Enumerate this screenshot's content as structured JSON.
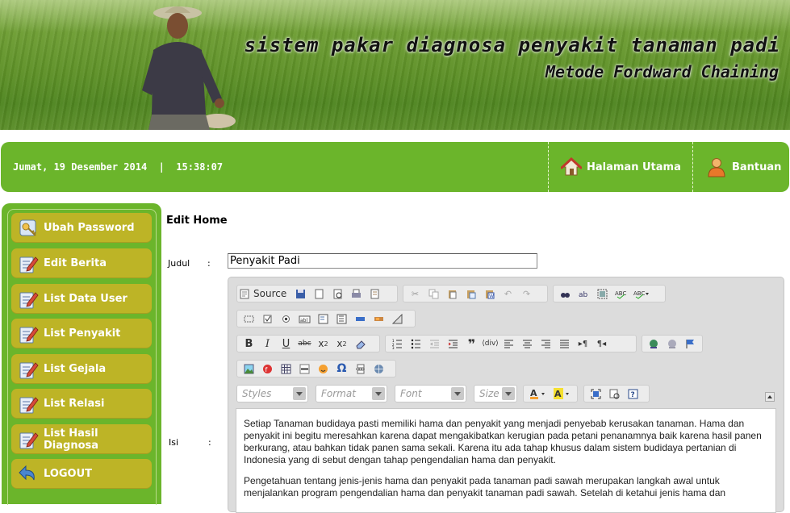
{
  "header": {
    "title": "sistem pakar diagnosa penyakit tanaman padi",
    "subtitle": "Metode Fordward Chaining"
  },
  "navbar": {
    "date": "Jumat, 19 Desember 2014",
    "separator": "|",
    "time": "15:38:07",
    "links": [
      {
        "label": "Halaman Utama",
        "icon": "home-icon"
      },
      {
        "label": "Bantuan",
        "icon": "user-help-icon"
      }
    ]
  },
  "sidebar": {
    "items": [
      {
        "label": "Ubah Password",
        "icon": "key-icon"
      },
      {
        "label": "Edit Berita",
        "icon": "edit-document-icon"
      },
      {
        "label": "List Data User",
        "icon": "edit-document-icon"
      },
      {
        "label": "List Penyakit",
        "icon": "edit-document-icon"
      },
      {
        "label": "List Gejala",
        "icon": "edit-document-icon"
      },
      {
        "label": "List Relasi",
        "icon": "edit-document-icon"
      },
      {
        "label": "List Hasil Diagnosa",
        "icon": "edit-document-icon"
      },
      {
        "label": "LOGOUT",
        "icon": "logout-arrow-icon"
      }
    ]
  },
  "form": {
    "page_title": "Edit Home",
    "judul_label": "Judul",
    "isi_label": "Isi",
    "colon": ":",
    "judul_value": "Penyakit Padi"
  },
  "editor": {
    "source_label": "Source",
    "styles_placeholder": "Styles",
    "format_placeholder": "Format",
    "font_placeholder": "Font",
    "size_placeholder": "Size",
    "paragraphs": [
      "Setiap Tanaman budidaya pasti memiliki hama dan penyakit yang menjadi penyebab kerusakan tanaman. Hama dan penyakit ini begitu meresahkan karena dapat mengakibatkan kerugian pada petani penanamnya baik karena hasil panen berkurang, atau bahkan tidak panen sama sekali. Karena itu ada tahap khusus dalam sistem budidaya pertanian di Indonesia yang di sebut dengan tahap pengendalian hama dan penyakit.",
      "Pengetahuan tentang jenis-jenis hama dan penyakit pada tanaman padi sawah merupakan langkah awal  untuk menjalankan program pengendalian hama dan penyakit tanaman padi sawah. Setelah di ketahui jenis hama dan"
    ]
  },
  "colors": {
    "nav_green": "#6bb52b",
    "menu_olive": "#bdb426"
  }
}
